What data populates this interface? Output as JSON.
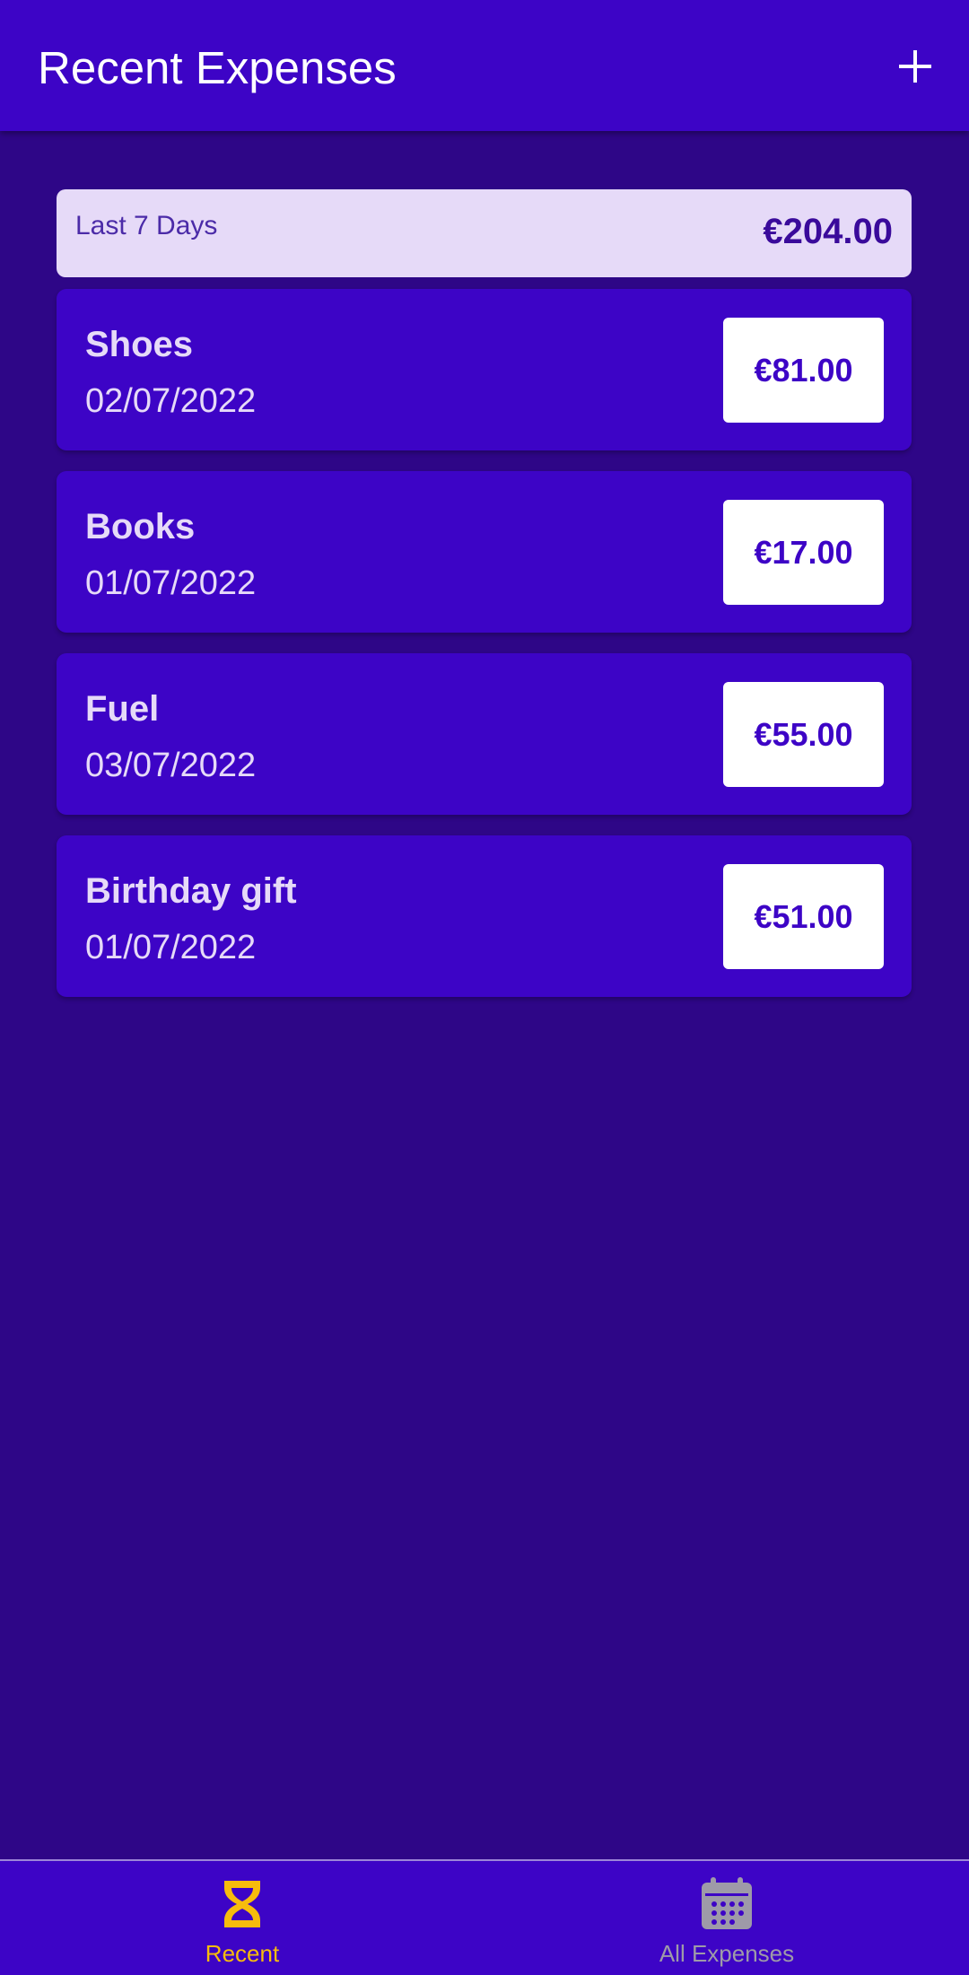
{
  "header": {
    "title": "Recent Expenses",
    "add_icon": "plus-icon"
  },
  "summary": {
    "period": "Last 7 Days",
    "total": "€204.00"
  },
  "expenses": [
    {
      "description": "Shoes",
      "date": "02/07/2022",
      "amount": "€81.00"
    },
    {
      "description": "Books",
      "date": "01/07/2022",
      "amount": "€17.00"
    },
    {
      "description": "Fuel",
      "date": "03/07/2022",
      "amount": "€55.00"
    },
    {
      "description": "Birthday gift",
      "date": "01/07/2022",
      "amount": "€51.00"
    }
  ],
  "bottom_nav": {
    "items": [
      {
        "label": "Recent",
        "icon": "hourglass-icon",
        "active": true
      },
      {
        "label": "All Expenses",
        "icon": "calendar-icon",
        "active": false
      }
    ]
  },
  "colors": {
    "primary": "#3d04c6",
    "background": "#2e0687",
    "accent": "#f7bc0c",
    "inactive": "#9e9aa8",
    "light": "#e6daf8"
  }
}
